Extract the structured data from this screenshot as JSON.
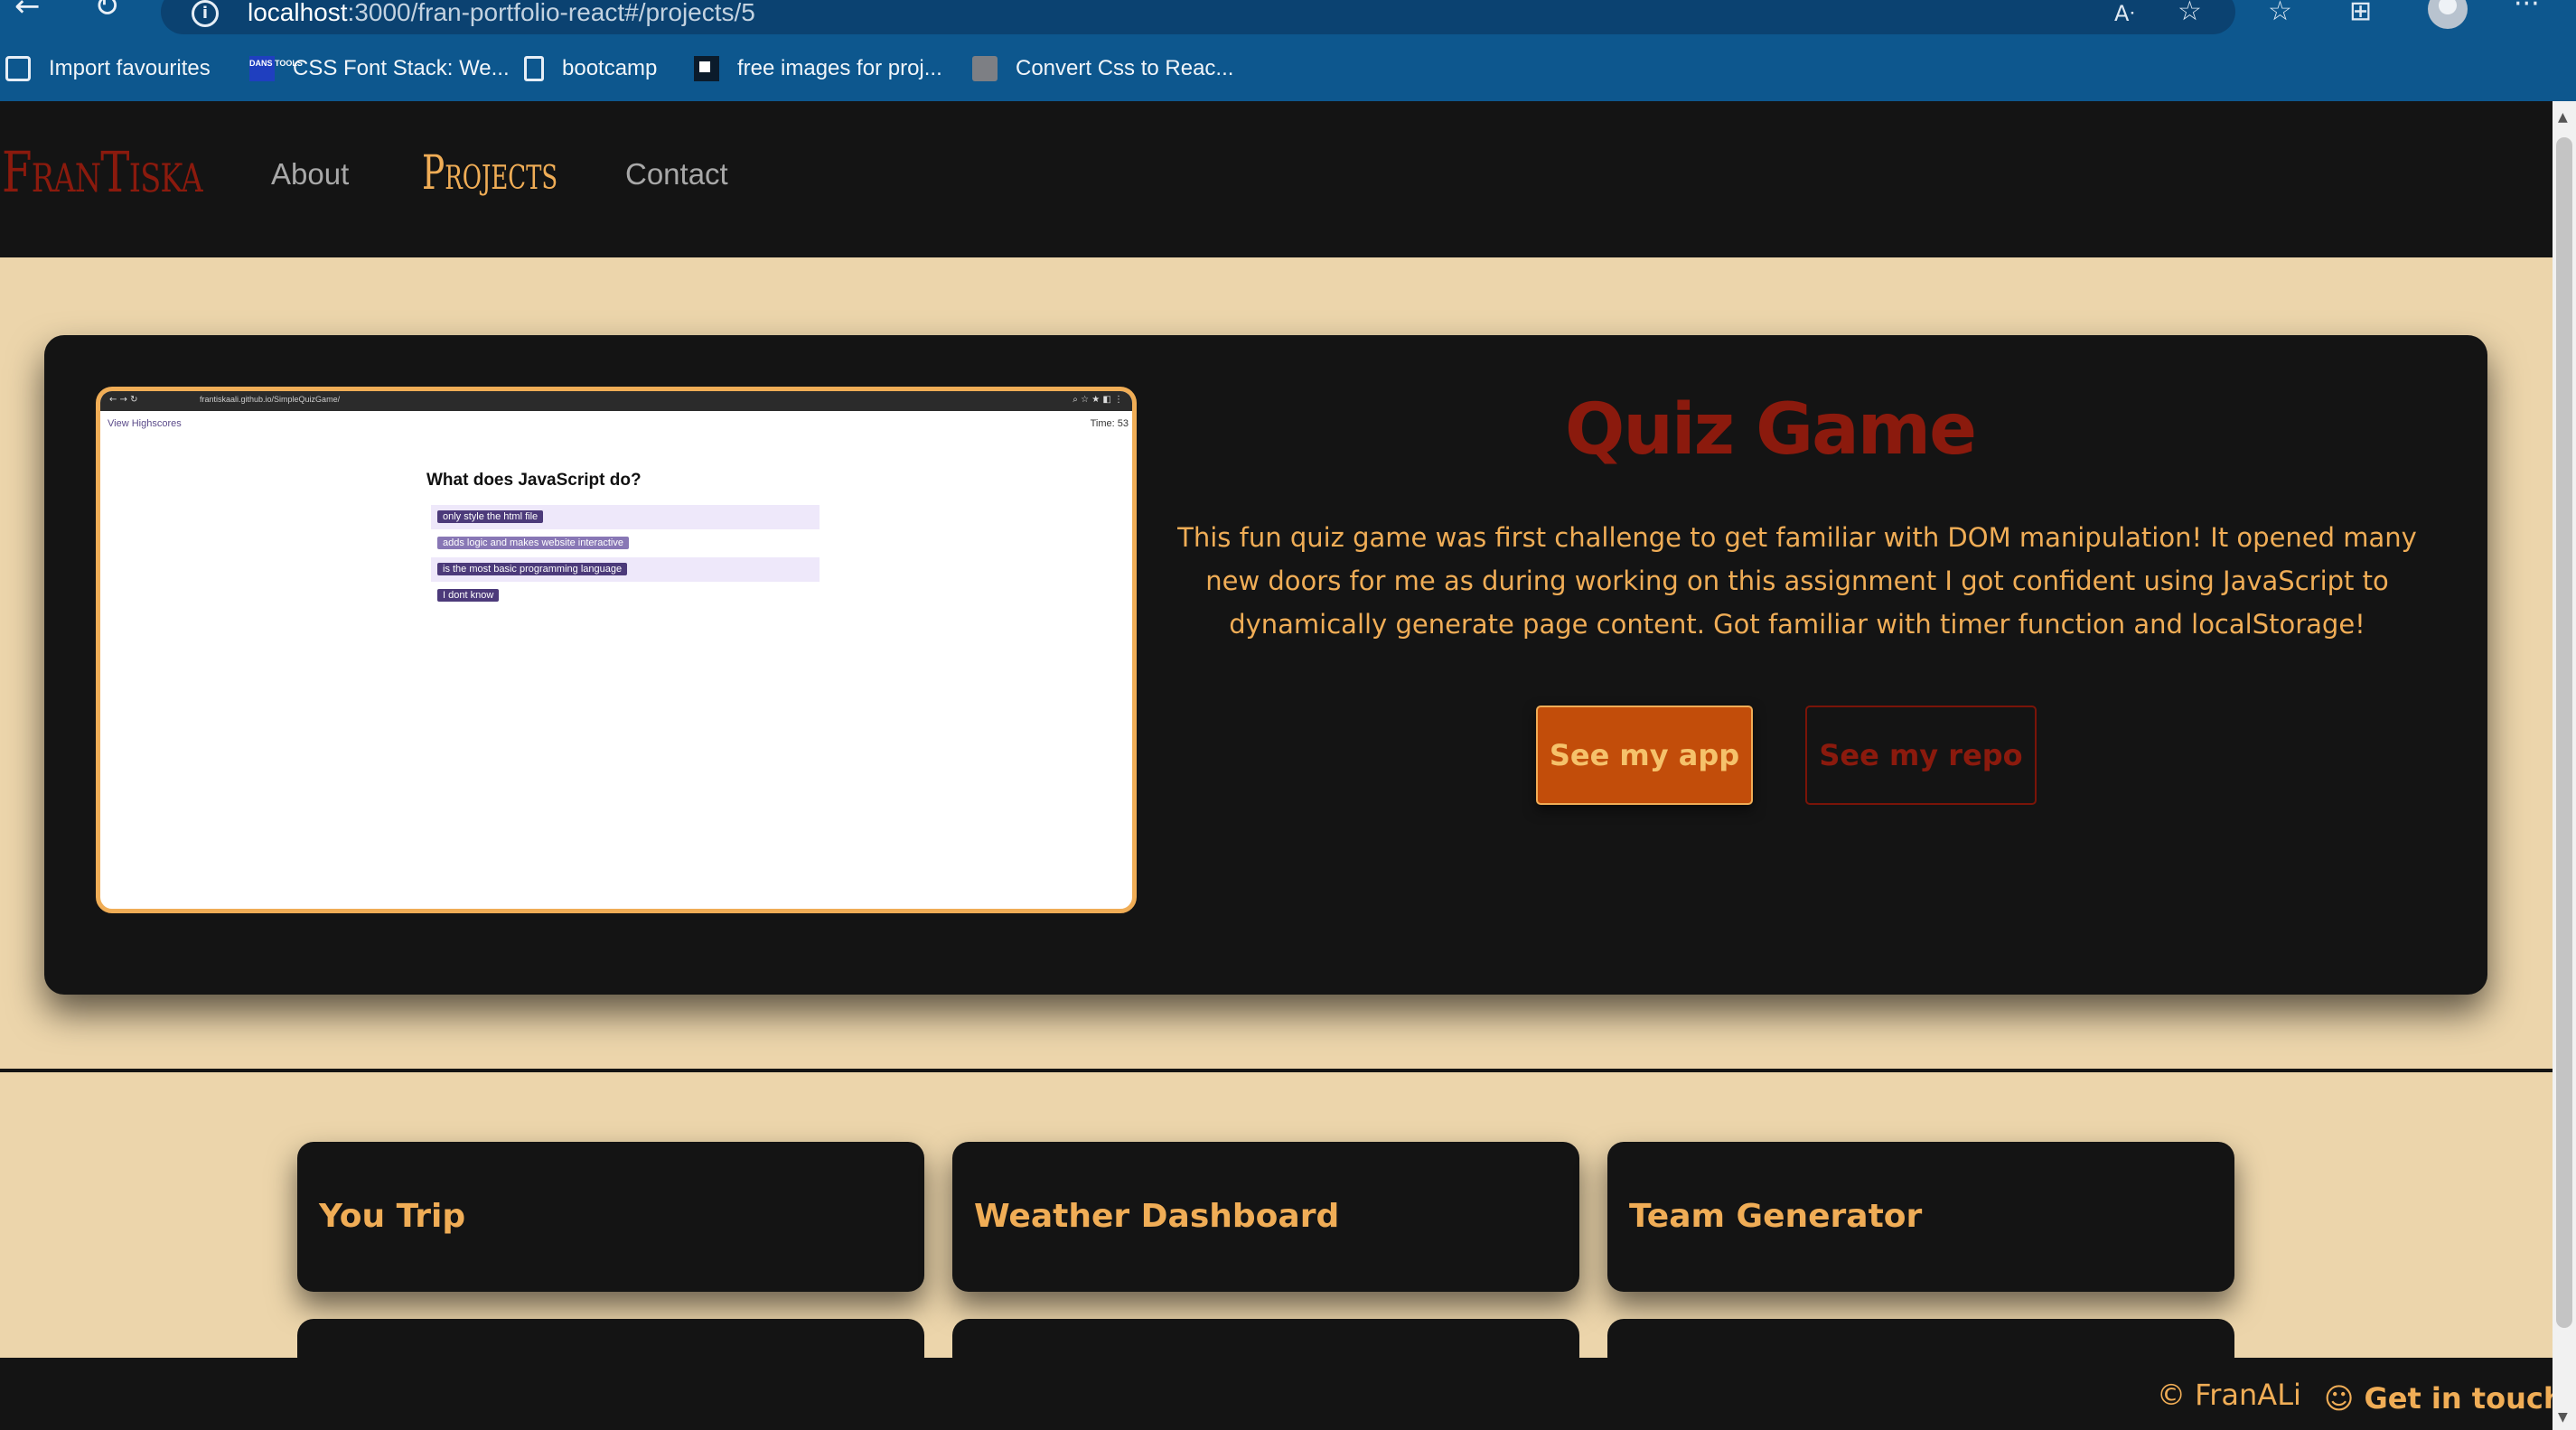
{
  "browser": {
    "url_host": "localhost",
    "url_rest": ":3000/fran-portfolio-react#/projects/5",
    "bookmarks": [
      {
        "label": "Import favourites",
        "icon": "import-icon"
      },
      {
        "label": "CSS Font Stack: We...",
        "icon": "dans-tools-icon",
        "icon_text": "DANS TOOLS"
      },
      {
        "label": "bootcamp",
        "icon": "page-icon"
      },
      {
        "label": "free images for proj...",
        "icon": "image-site-icon"
      },
      {
        "label": "Convert Css to Reac...",
        "icon": "photo-icon"
      }
    ],
    "toolbar_icons": [
      "read-aloud-icon",
      "add-favourite-icon",
      "favourites-icon",
      "collections-icon",
      "profile-icon",
      "more-icon"
    ]
  },
  "nav": {
    "logo": "FranTiska",
    "links": [
      "About",
      "Projects",
      "Contact"
    ],
    "active": "Projects"
  },
  "project": {
    "title": "Quiz Game",
    "description": "This fun quiz game was first challenge to get familiar with DOM manipulation! It opened many new doors for me as during working on this assignment I got confident using JavaScript to dynamically generate page content. Got familiar with timer function and localStorage!",
    "app_button": "See my app",
    "repo_button": "See my repo",
    "screenshot": {
      "url": "frantiskaali.github.io/SimpleQuizGame/",
      "view_highscores": "View Highscores",
      "time": "Time: 53",
      "question": "What does JavaScript do?",
      "options": [
        "only style the html file",
        "adds logic and makes website interactive",
        "is the most basic programming language",
        "I dont know"
      ]
    }
  },
  "cards": [
    {
      "title": "You Trip"
    },
    {
      "title": "Weather Dashboard"
    },
    {
      "title": "Team Generator"
    }
  ],
  "footer": {
    "copyright": "© FranALi",
    "contact": "☺ Get in touch"
  },
  "colors": {
    "accent": "#f0ad56",
    "brand_red": "#8b1a0d",
    "page_bg": "#ecd5ab",
    "dark": "#141414",
    "chrome_blue": "#0d578e"
  }
}
